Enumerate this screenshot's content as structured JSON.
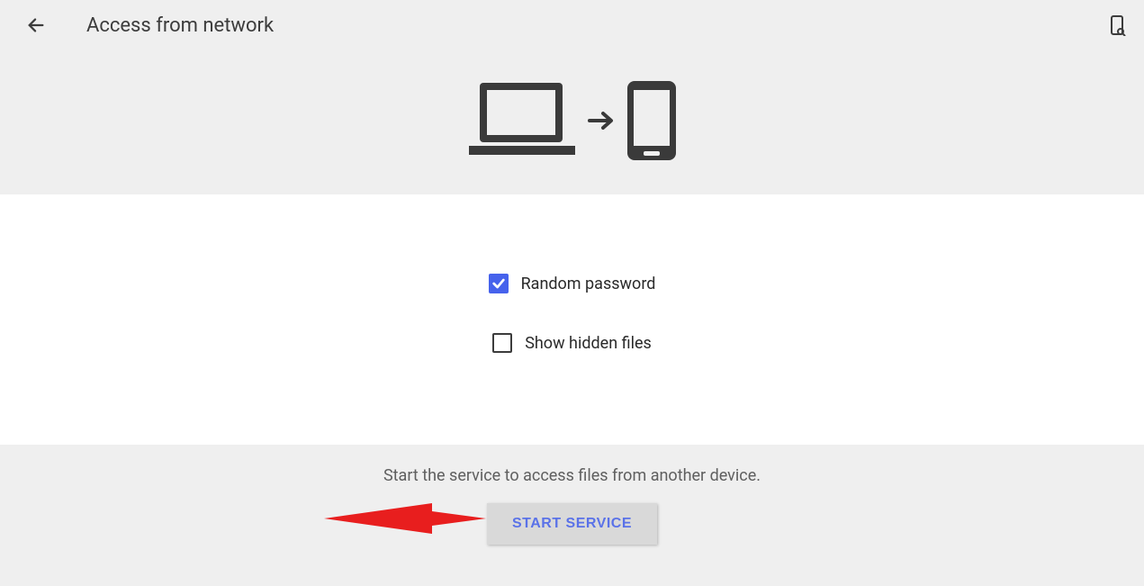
{
  "header": {
    "title": "Access from network"
  },
  "options": {
    "random_password": {
      "label": "Random password",
      "checked": true
    },
    "show_hidden_files": {
      "label": "Show hidden files",
      "checked": false
    }
  },
  "footer": {
    "hint": "Start the service to access files from another device.",
    "button_label": "START SERVICE"
  }
}
